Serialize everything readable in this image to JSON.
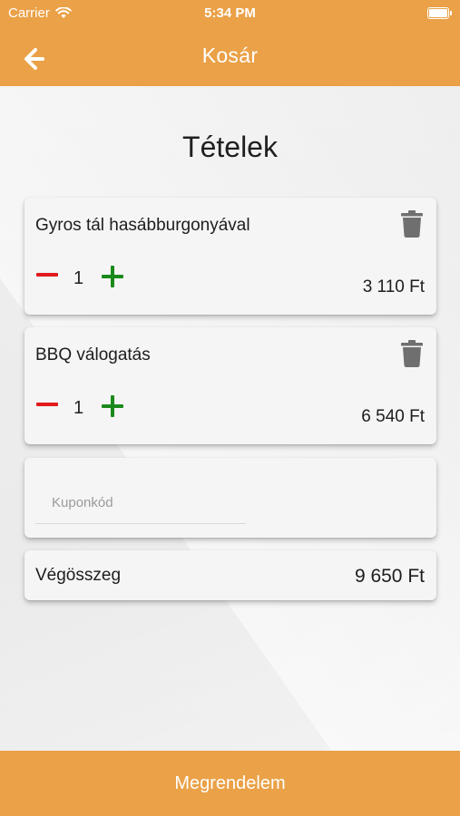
{
  "status_bar": {
    "carrier": "Carrier",
    "time": "5:34 PM"
  },
  "header": {
    "title": "Kosár",
    "back_icon": "arrow-left-icon"
  },
  "section_title": "Tételek",
  "items": [
    {
      "name": "Gyros tál hasábburgonyával",
      "quantity": "1",
      "price": "3 110 Ft"
    },
    {
      "name": "BBQ válogatás",
      "quantity": "1",
      "price": "6 540 Ft"
    }
  ],
  "coupon": {
    "placeholder": "Kuponkód",
    "value": ""
  },
  "total": {
    "label": "Végösszeg",
    "value": "9 650 Ft"
  },
  "footer": {
    "button_label": "Megrendelem"
  },
  "colors": {
    "accent": "#eaa147",
    "minus": "#e11b1b",
    "plus": "#1a8a1a",
    "trash": "#6f6f6f"
  }
}
